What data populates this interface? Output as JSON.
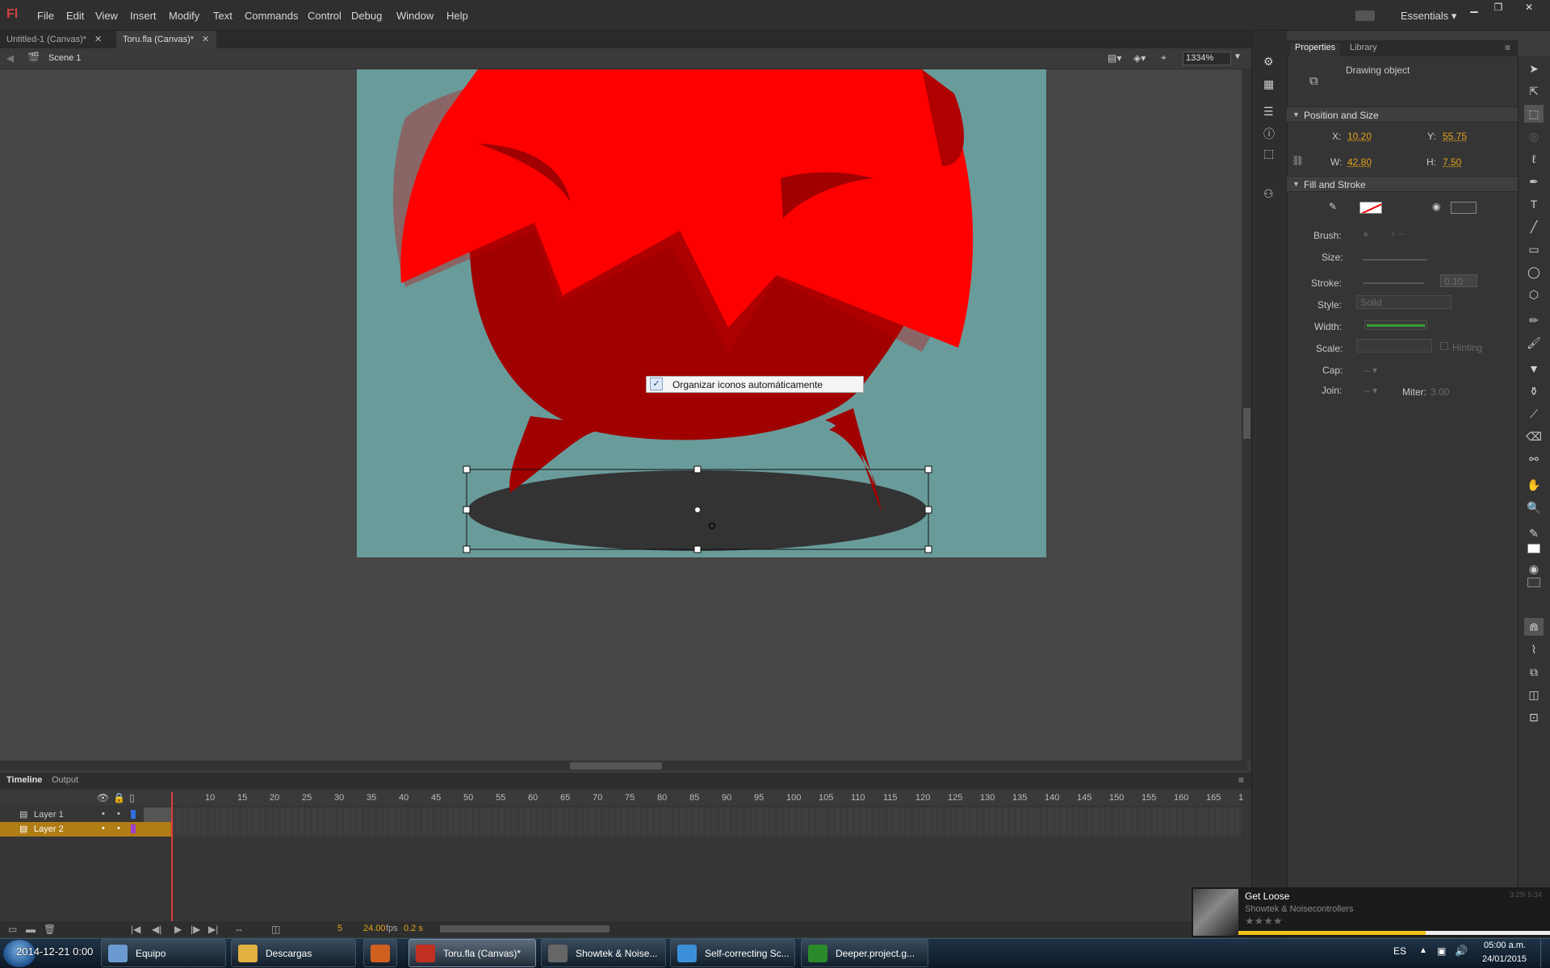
{
  "app": {
    "logo": "Fl",
    "menus": [
      "File",
      "Edit",
      "View",
      "Insert",
      "Modify",
      "Text",
      "Commands",
      "Control",
      "Debug",
      "Window",
      "Help"
    ],
    "workspace": "Essentials"
  },
  "doc_tabs": [
    {
      "label": "Untitled-1 (Canvas)*",
      "active": false
    },
    {
      "label": "Toru.fla (Canvas)*",
      "active": true
    }
  ],
  "edit_bar": {
    "scene": "Scene 1",
    "zoom": "1334%"
  },
  "context_menu": {
    "item": "Organizar iconos automáticamente",
    "checked": true
  },
  "timeline": {
    "tabs": [
      "Timeline",
      "Output"
    ],
    "ticks": [
      "10",
      "15",
      "20",
      "25",
      "30",
      "35",
      "40",
      "45",
      "50",
      "55",
      "60",
      "65",
      "70",
      "75",
      "80",
      "85",
      "90",
      "95",
      "100",
      "105",
      "110",
      "115",
      "120",
      "125",
      "130",
      "135",
      "140",
      "145",
      "150",
      "155",
      "160",
      "165",
      "1"
    ],
    "layers": [
      {
        "name": "Layer 1",
        "selected": false,
        "color": "#2f6fe0"
      },
      {
        "name": "Layer 2",
        "selected": true,
        "color": "#a040d0"
      }
    ],
    "current_frame": "5",
    "fps": "24.00",
    "fps_unit": "fps",
    "time": "0.2 s"
  },
  "properties": {
    "tabs": [
      "Properties",
      "Library"
    ],
    "object_type": "Drawing object",
    "position_size": {
      "title": "Position and Size",
      "x_label": "X:",
      "x": "10.20",
      "y_label": "Y:",
      "y": "55.75",
      "w_label": "W:",
      "w": "42.80",
      "h_label": "H:",
      "h": "7.50"
    },
    "fill_stroke": {
      "title": "Fill and Stroke",
      "brush_label": "Brush:",
      "size_label": "Size:",
      "stroke_label": "Stroke:",
      "stroke_value": "0.10",
      "style_label": "Style:",
      "style_value": "Solid",
      "width_label": "Width:",
      "scale_label": "Scale:",
      "hinting_label": "Hinting",
      "cap_label": "Cap:",
      "join_label": "Join:",
      "miter_label": "Miter:",
      "miter_value": "3.00",
      "fill_color": "#3a3a3a"
    }
  },
  "now_playing": {
    "title": "Get Loose",
    "artist": "Showtek & Noisecontrollers",
    "time": "3:29/ 5:34",
    "rating": "★★★★",
    "progress": 0.6
  },
  "taskbar": {
    "overlay_text": "2014-12-21 0:00",
    "items": [
      {
        "label": "Equipo",
        "active": false
      },
      {
        "label": "Descargas",
        "active": false
      },
      {
        "label": "",
        "active": false
      },
      {
        "label": "Toru.fla (Canvas)*",
        "active": true
      },
      {
        "label": "Showtek & Noise...",
        "active": false
      },
      {
        "label": "Self-correcting Sc...",
        "active": false
      },
      {
        "label": "Deeper.project.g...",
        "active": false
      }
    ],
    "lang": "ES",
    "clock_time": "05:00 a.m.",
    "clock_date": "24/01/2015"
  },
  "colors": {
    "stage_bg": "#6a9b9b",
    "head_red": "#ff0000",
    "body_dark_red": "#a00000",
    "shadow": "#333333",
    "accent_orange": "#e3a21a"
  }
}
